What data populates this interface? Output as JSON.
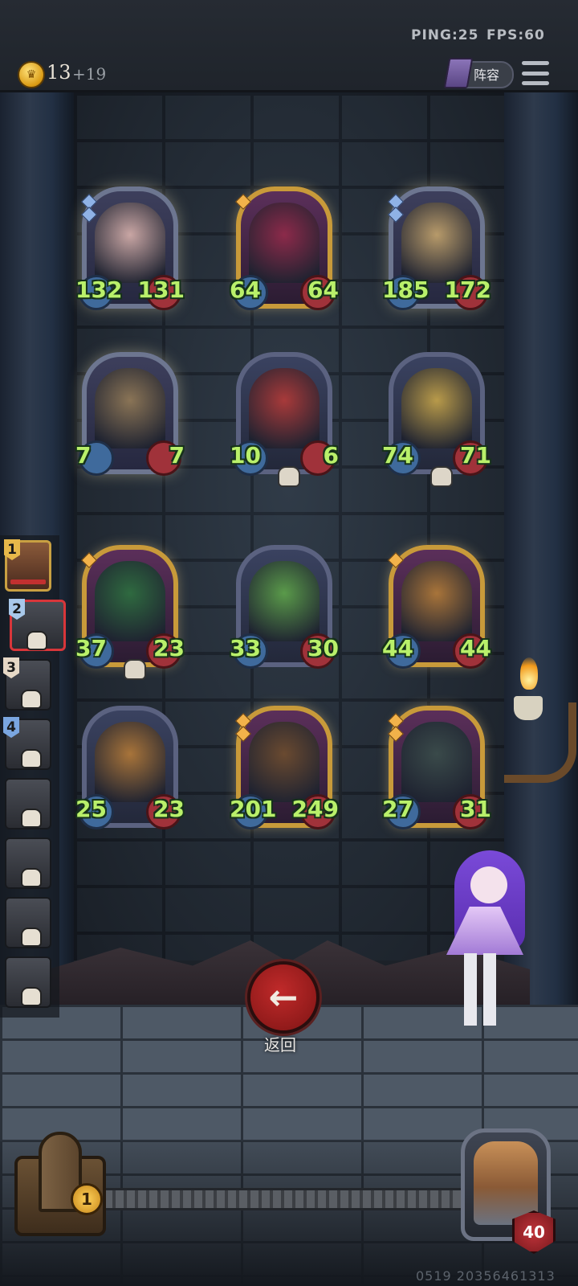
{
  "hud": {
    "ping_label": "PING:25",
    "fps_label": "FPS:60",
    "gold": "13",
    "gold_income": "+19",
    "lineup_label": "阵容"
  },
  "shop": {
    "cards": [
      {
        "attack": "132",
        "health": "131",
        "frame": "silver",
        "tier_gems": 2,
        "gem_color": "blue",
        "portrait_color": "#c9a6a4"
      },
      {
        "attack": "64",
        "health": "64",
        "frame": "gold",
        "tier_gems": 1,
        "gem_color": "orange",
        "portrait_color": "#8c2a4a"
      },
      {
        "attack": "185",
        "health": "172",
        "frame": "silver",
        "tier_gems": 2,
        "gem_color": "blue",
        "portrait_color": "#b79a6a"
      },
      {
        "attack": "7",
        "health": "7",
        "frame": "silver",
        "tier_gems": 0,
        "gem_color": "",
        "portrait_color": "#8a7456"
      },
      {
        "attack": "10",
        "health": "6",
        "frame": "plain",
        "tier_gems": 0,
        "gem_color": "",
        "portrait_color": "#a83a3a",
        "skull": true
      },
      {
        "attack": "74",
        "health": "71",
        "frame": "plain",
        "tier_gems": 0,
        "gem_color": "",
        "portrait_color": "#b89a4a",
        "skull": true
      },
      {
        "attack": "37",
        "health": "23",
        "frame": "gold",
        "tier_gems": 1,
        "gem_color": "orange",
        "portrait_color": "#2f6a40",
        "skull": true
      },
      {
        "attack": "33",
        "health": "30",
        "frame": "plain",
        "tier_gems": 0,
        "gem_color": "",
        "portrait_color": "#5a9a4a"
      },
      {
        "attack": "44",
        "health": "44",
        "frame": "gold",
        "tier_gems": 1,
        "gem_color": "orange",
        "portrait_color": "#a8743a"
      },
      {
        "attack": "25",
        "health": "23",
        "frame": "plain",
        "tier_gems": 0,
        "gem_color": "",
        "portrait_color": "#a8743a"
      },
      {
        "attack": "201",
        "health": "249",
        "frame": "gold",
        "tier_gems": 2,
        "gem_color": "orange",
        "portrait_color": "#6a4a30"
      },
      {
        "attack": "27",
        "health": "31",
        "frame": "gold",
        "tier_gems": 2,
        "gem_color": "orange",
        "portrait_color": "#3a4a4a"
      }
    ]
  },
  "roster": {
    "slots": [
      {
        "number": "1",
        "badge_color": "#e7b84a",
        "state": "active"
      },
      {
        "number": "2",
        "badge_color": "#a8c8ea",
        "state": "selected"
      },
      {
        "number": "3",
        "badge_color": "#e6d8c6",
        "state": "normal"
      },
      {
        "number": "4",
        "badge_color": "#7aa6e0",
        "state": "normal"
      },
      {
        "number": "",
        "badge_color": "",
        "state": "normal"
      },
      {
        "number": "",
        "badge_color": "",
        "state": "normal"
      },
      {
        "number": "",
        "badge_color": "",
        "state": "normal"
      },
      {
        "number": "",
        "badge_color": "",
        "state": "normal"
      }
    ]
  },
  "controls": {
    "return_label": "返回",
    "return_icon": "arrow-left-icon"
  },
  "tavern": {
    "level": "1"
  },
  "player_hero": {
    "health": "40"
  },
  "build_id": "0519 20356461313",
  "colors": {
    "stat_green": "#b9f06a",
    "gold_frame": "#c89a3a",
    "silver_frame": "#6d7690",
    "return_red": "#c02a2a"
  }
}
